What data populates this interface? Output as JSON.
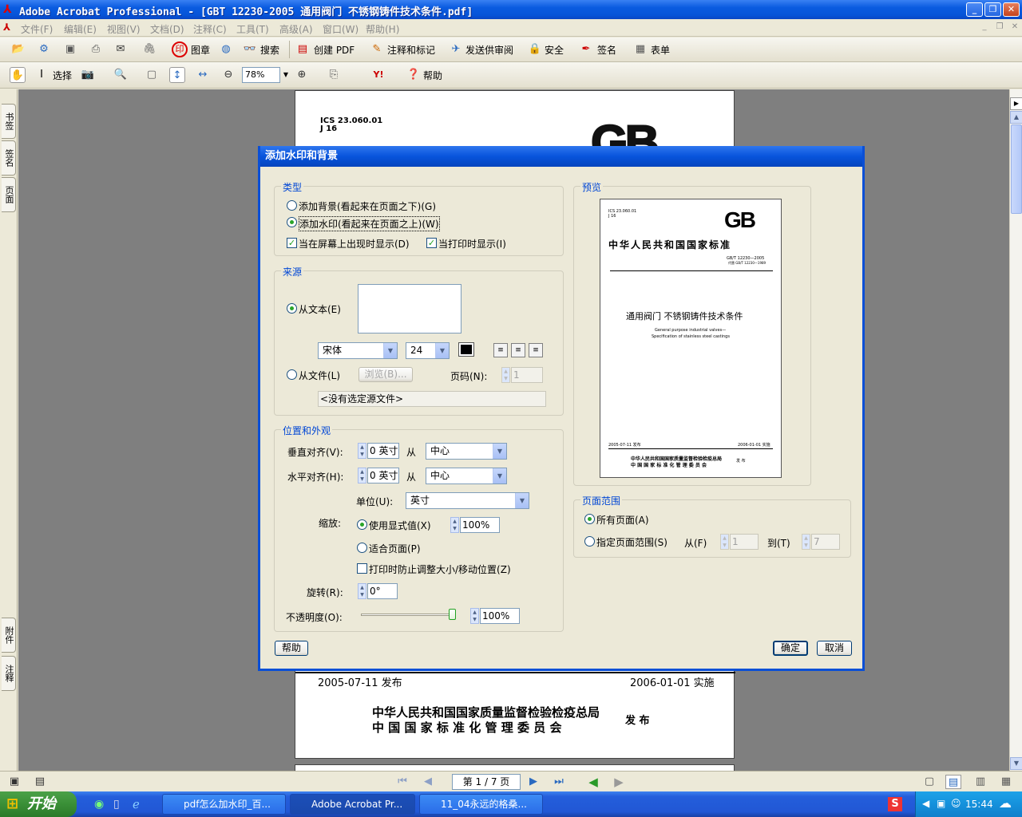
{
  "window": {
    "title": "Adobe Acrobat Professional - [GBT 12230-2005 通用阀门 不锈钢铸件技术条件.pdf]",
    "controls": [
      "_",
      "❐",
      "✕"
    ]
  },
  "menu": {
    "items": [
      "文件(F)",
      "编辑(E)",
      "视图(V)",
      "文档(D)",
      "注释(C)",
      "工具(T)",
      "高级(A)",
      "窗口(W)",
      "帮助(H)"
    ]
  },
  "toolbar1": {
    "stamp": "图章",
    "search": "搜索",
    "create_pdf": "创建 PDF",
    "comment": "注释和标记",
    "send_review": "发送供审阅",
    "security": "安全",
    "sign": "签名",
    "forms": "表单"
  },
  "toolbar2": {
    "select": "选择",
    "zoom": "78%",
    "help": "帮助"
  },
  "left_tabs": {
    "bookmarks": "书签",
    "signatures": "签名",
    "pages": "页面",
    "attachments": "附件",
    "comments": "注释"
  },
  "document": {
    "ics": "ICS 23.060.01",
    "j": "J 16",
    "logo": "GB",
    "publish_date": "2005-07-11 发布",
    "implement_date": "2006-01-01 实施",
    "issuer_line1": "中华人民共和国国家质量监督检验检疫总局",
    "issuer_line2": "中 国 国 家 标 准 化 管 理 委 员 会",
    "issuer_suffix": "发 布"
  },
  "dialog": {
    "title": "添加水印和背景",
    "type": {
      "legend": "类型",
      "add_background": "添加背景(看起来在页面之下)(G)",
      "add_watermark": "添加水印(看起来在页面之上)(W)",
      "show_on_screen": "当在屏幕上出现时显示(D)",
      "show_on_print": "当打印时显示(I)"
    },
    "source": {
      "legend": "来源",
      "from_text": "从文本(E)",
      "font": "宋体",
      "font_size": "24",
      "from_file": "从文件(L)",
      "browse": "浏览(B)...",
      "page_number_label": "页码(N):",
      "page_number_value": "1",
      "no_file": "<没有选定源文件>"
    },
    "position": {
      "legend": "位置和外观",
      "vertical_label": "垂直对齐(V):",
      "vertical_value": "0 英寸",
      "from1": "从",
      "vertical_anchor": "中心",
      "horizontal_label": "水平对齐(H):",
      "horizontal_value": "0 英寸",
      "from2": "从",
      "horizontal_anchor": "中心",
      "unit_label": "单位(U):",
      "unit_value": "英寸",
      "scale_label": "缩放:",
      "use_display": "使用显式值(X)",
      "scale_value": "100%",
      "fit_page": "适合页面(P)",
      "prevent_resize": "打印时防止调整大小/移动位置(Z)",
      "rotation_label": "旋转(R):",
      "rotation_value": "0°",
      "opacity_label": "不透明度(O):",
      "opacity_value": "100%"
    },
    "preview": {
      "legend": "预览",
      "ics": "ICS 23.060.01",
      "j": "J 16",
      "logo": "GB",
      "national_standard": "中华人民共和国国家标准",
      "code": "GB/T 12230—2005",
      "replaces": "代替 GB/T 12230—1989",
      "doc_title": "通用阀门  不锈钢铸件技术条件",
      "en_title1": "General purpose industrial valves—",
      "en_title2": "Specification of stainless steel castings",
      "publish": "2005-07-11 发布",
      "implement": "2006-01-01 实施",
      "issuer1": "中华人民共和国国家质量监督检验检疫总局",
      "issuer2": "中 国 国 家 标 准 化 管 理 委 员 会",
      "issuer_suffix": "发 布"
    },
    "page_range": {
      "legend": "页面范围",
      "all_pages": "所有页面(A)",
      "specify": "指定页面范围(S)",
      "from_label": "从(F)",
      "from_value": "1",
      "to_label": "到(T)",
      "to_value": "7"
    },
    "buttons": {
      "help": "帮助",
      "ok": "确定",
      "cancel": "取消"
    }
  },
  "statusbar": {
    "page": "第 1 / 7 页"
  },
  "taskbar": {
    "start": "开始",
    "tasks": [
      "pdf怎么加水印_百...",
      "Adobe Acrobat Pr...",
      "11_04永远的格桑..."
    ],
    "clock": "15:44"
  }
}
